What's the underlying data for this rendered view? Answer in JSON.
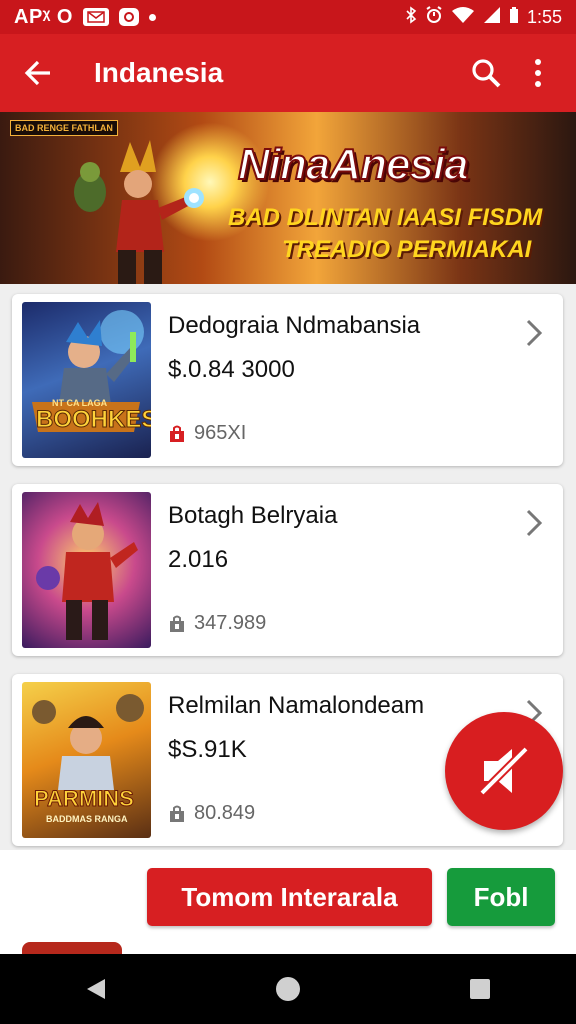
{
  "status_bar": {
    "app_label": "APᵡ O",
    "time": "1:55",
    "left_icons": [
      "mail-icon",
      "circle-app-icon",
      "dot-icon"
    ],
    "right_icons": [
      "bluetooth-icon",
      "alarm-icon",
      "wifi-icon",
      "signal-icon",
      "battery-icon"
    ]
  },
  "app_bar": {
    "title": "Indanesia",
    "back_icon": "arrow-back-icon",
    "search_icon": "search-icon",
    "menu_icon": "more-vert-icon",
    "color": "#d71f22"
  },
  "banner": {
    "badge": "BAD RENGE FATHLAN",
    "title": "NinaAnesia",
    "line1": "BAD DLINTAN IAASI FISDM",
    "line2": "TREADIO PERMIAKAI"
  },
  "items": [
    {
      "name": "Dedograia Ndmabansia",
      "price": "$.0.84 3000",
      "meta": "965XI",
      "meta_icon": "red-bag-icon",
      "thumb_text": "BOOHKES",
      "thumb_sub": "NT CA LAGA",
      "chevron": "chevron-right-icon"
    },
    {
      "name": "Botagh Belryaia",
      "price": "2.016",
      "meta": "347.989",
      "meta_icon": "bag-icon",
      "thumb_text": "",
      "thumb_sub": "",
      "chevron": "chevron-right-icon"
    },
    {
      "name": "Relmilan Namalondeam",
      "price": "$S.91K",
      "meta": "80.849",
      "meta_icon": "bag-icon",
      "thumb_text": "PARMINS",
      "thumb_sub": "BADDMAS RANGA",
      "chevron": "chevron-right-icon"
    }
  ],
  "fab": {
    "icon": "mute-icon",
    "color": "#d81e20"
  },
  "actions": {
    "primary_label": "Tomom Interarala",
    "secondary_label": "Fobl",
    "primary_color": "#d71f22",
    "secondary_color": "#169b3c"
  },
  "nav": {
    "back": "nav-back-icon",
    "home": "nav-home-icon",
    "recents": "nav-recents-icon"
  }
}
